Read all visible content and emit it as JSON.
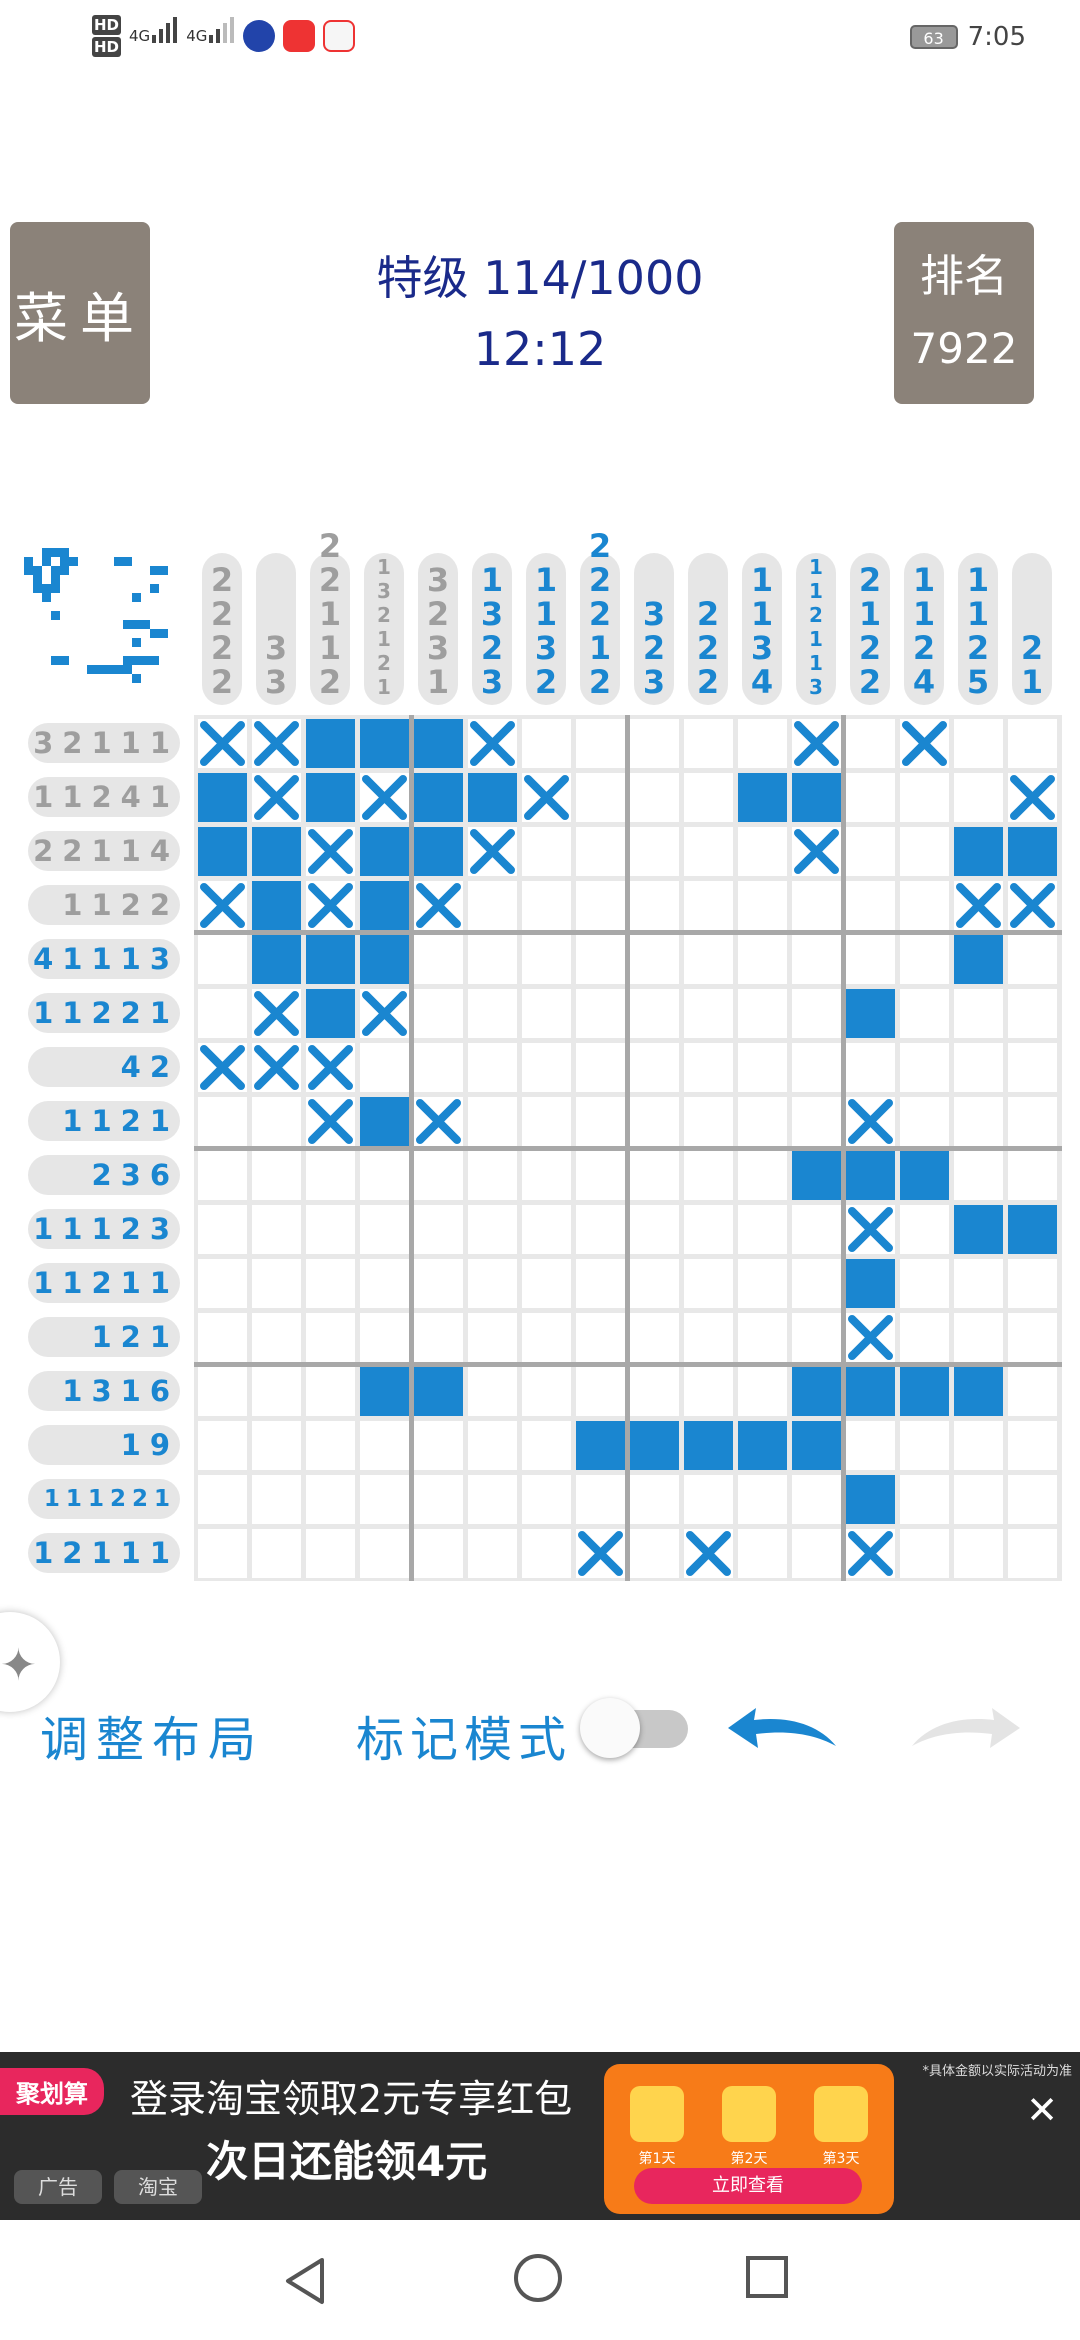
{
  "status_bar": {
    "hd1": "HD",
    "hd2": "HD",
    "net1": "4G",
    "net2": "4G",
    "battery": "63",
    "time": "7:05"
  },
  "header": {
    "menu_label": "菜单",
    "level": "特级 114/1000",
    "timer": "12:12",
    "rank_title": "排名",
    "rank_value": "7922"
  },
  "puzzle": {
    "size": 15,
    "column_clues": [
      {
        "nums": [
          "2",
          "2",
          "2",
          "2"
        ],
        "done": true
      },
      {
        "nums": [
          "3",
          "3"
        ],
        "done": true
      },
      {
        "nums": [
          "2",
          "2",
          "1",
          "1",
          "2"
        ],
        "done": true
      },
      {
        "nums": [
          "1",
          "3",
          "2",
          "1",
          "2",
          "1"
        ],
        "done": true
      },
      {
        "nums": [
          "3",
          "2",
          "3",
          "1"
        ],
        "done": true
      },
      {
        "nums": [
          "1",
          "3",
          "2",
          "3"
        ],
        "done": false
      },
      {
        "nums": [
          "1",
          "1",
          "3",
          "2"
        ],
        "done": false
      },
      {
        "nums": [
          "2",
          "2",
          "2",
          "1",
          "2"
        ],
        "done": false
      },
      {
        "nums": [
          "3",
          "2",
          "3"
        ],
        "done": false
      },
      {
        "nums": [
          "2",
          "2",
          "2"
        ],
        "done": false
      },
      {
        "nums": [
          "1",
          "1",
          "3",
          "4"
        ],
        "done": false
      },
      {
        "nums": [
          "1",
          "1",
          "2",
          "1",
          "1",
          "3"
        ],
        "done": false
      },
      {
        "nums": [
          "2",
          "1",
          "2",
          "2"
        ],
        "done": false
      },
      {
        "nums": [
          "1",
          "1",
          "2",
          "4"
        ],
        "done": false
      },
      {
        "nums": [
          "1",
          "1",
          "2",
          "5"
        ],
        "done": false
      },
      {
        "nums": [
          "2",
          "1"
        ],
        "done": false
      }
    ],
    "row_clues": [
      {
        "nums": [
          "3",
          "2",
          "1",
          "1",
          "1"
        ],
        "done": true
      },
      {
        "nums": [
          "1",
          "1",
          "2",
          "4",
          "1"
        ],
        "done": true
      },
      {
        "nums": [
          "2",
          "2",
          "1",
          "1",
          "4"
        ],
        "done": true
      },
      {
        "nums": [
          "1",
          "1",
          "2",
          "2"
        ],
        "done": true
      },
      {
        "nums": [
          "4",
          "1",
          "1",
          "1",
          "3"
        ],
        "done": false
      },
      {
        "nums": [
          "1",
          "1",
          "2",
          "2",
          "1"
        ],
        "done": false
      },
      {
        "nums": [
          "4",
          "2"
        ],
        "done": false
      },
      {
        "nums": [
          "1",
          "1",
          "2",
          "1"
        ],
        "done": false
      },
      {
        "nums": [
          "2",
          "3",
          "6"
        ],
        "done": false
      },
      {
        "nums": [
          "1",
          "1",
          "1",
          "2",
          "3"
        ],
        "done": false
      },
      {
        "nums": [
          "1",
          "1",
          "2",
          "1",
          "1"
        ],
        "done": false
      },
      {
        "nums": [
          "1",
          "2",
          "1"
        ],
        "done": false
      },
      {
        "nums": [
          "1",
          "3",
          "1",
          "6"
        ],
        "done": false
      },
      {
        "nums": [
          "1",
          "9"
        ],
        "done": false
      },
      {
        "nums": [
          "1",
          "1",
          "1",
          "2",
          "2",
          "1"
        ],
        "done": false
      },
      {
        "nums": [
          "1",
          "2",
          "1",
          "1",
          "1"
        ],
        "done": false
      }
    ],
    "grid": [
      "XXFFFX.....X.X...",
      "FXFXFFX...FF...XX",
      "FFXFFX.....X..FFF",
      "XFXFX.........XXX",
      ".FFF..........F..",
      ".XFX........F....",
      "XXX..............",
      "..XFX.......X....",
      "...........FFF...",
      "............X.FF.",
      "............F....",
      "............X....",
      "...FF......FFFF..",
      ".......FFFFF.....",
      "............F....",
      ".......X.X..X...."
    ]
  },
  "controls": {
    "adjust_layout": "调整布局",
    "mark_mode": "标记模式",
    "mark_mode_on": false
  },
  "ad": {
    "tag": "聚划算",
    "line1": "登录淘宝领取2元专享红包",
    "line2": "次日还能领4元",
    "chip_ad": "广告",
    "chip_source": "淘宝",
    "days": [
      "第1天",
      "第2天",
      "第3天"
    ],
    "cta": "立即查看",
    "fine_print": "*具体金额以实际活动为准",
    "close": "✕"
  },
  "colors": {
    "accent": "#1a86d0",
    "button_bg": "#8b8279",
    "title": "#1a2a8a",
    "clue_done": "#9e9e9e"
  }
}
